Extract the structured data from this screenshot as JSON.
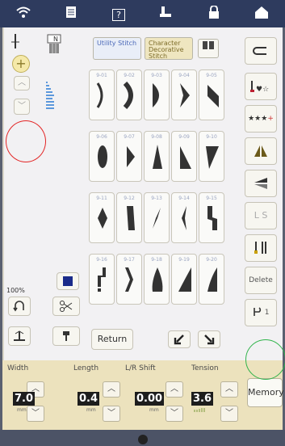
{
  "topbar": {
    "icons": [
      "wifi-icon",
      "document-icon",
      "help-icon",
      "presser-foot-icon",
      "lock-icon",
      "home-icon"
    ],
    "help_label": "?"
  },
  "tabs": {
    "utility": "Utility Stitch",
    "character": "Character Decorative Stitch"
  },
  "zoom": "100%",
  "stitches": {
    "numbers": [
      "9-01",
      "9-02",
      "9-03",
      "9-04",
      "9-05",
      "9-06",
      "9-07",
      "9-08",
      "9-09",
      "9-10",
      "9-11",
      "9-12",
      "9-13",
      "9-14",
      "9-15",
      "9-16",
      "9-17",
      "9-18",
      "9-19",
      "9-20"
    ]
  },
  "right_panel": {
    "ls_label": "L S",
    "delete_label": "Delete",
    "count_label": "1"
  },
  "return_label": "Return",
  "settings": {
    "width_label": "Width",
    "width_value": "7.0",
    "length_label": "Length",
    "length_value": "0.4",
    "shift_label": "L/R Shift",
    "shift_value": "0.00",
    "tension_label": "Tension",
    "tension_value": "3.6",
    "unit": "mm",
    "memory_label": "Memory"
  },
  "colors": {
    "accent_tab": "#e9eef8",
    "char_tab": "#efe6c0",
    "band": "#ece2bd",
    "annotation_red": "#e32525",
    "annotation_green": "#2fb34a"
  }
}
